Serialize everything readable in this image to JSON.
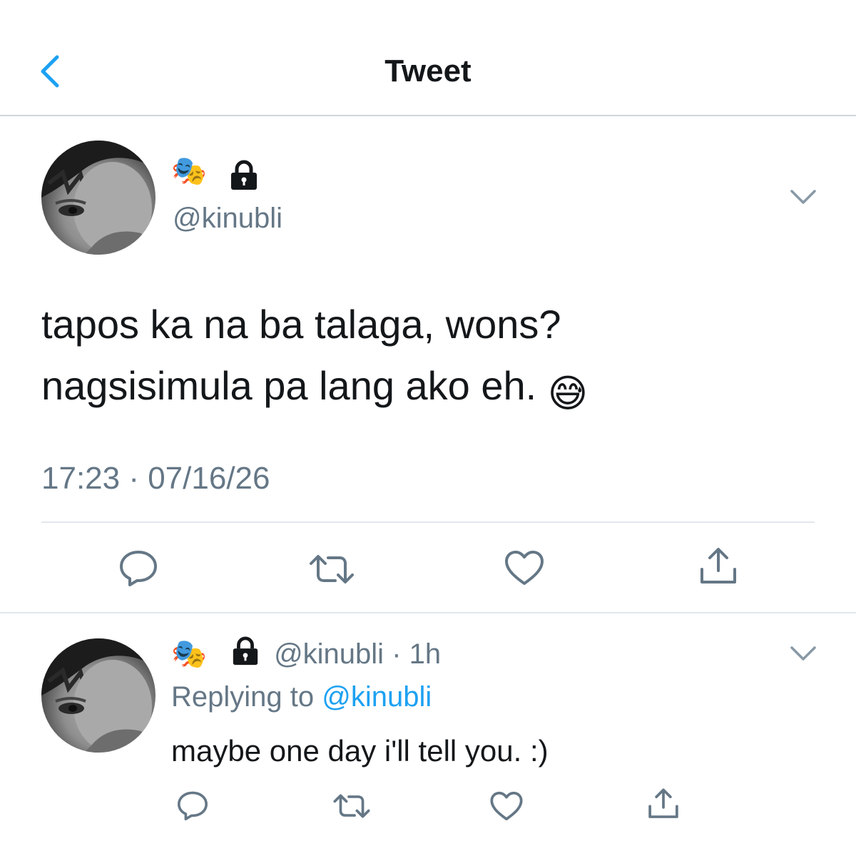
{
  "header": {
    "title": "Tweet",
    "back_icon": "chevron-left-icon"
  },
  "colors": {
    "accent": "#1da1f2",
    "secondary_text": "#657786",
    "divider": "#e1e8ed"
  },
  "main_tweet": {
    "display_name_emoji": "🎭",
    "locked": true,
    "handle": "@kinubli",
    "text_line1": "tapos ka na ba talaga, wons?",
    "text_line2": "nagsisimula pa lang ako eh.",
    "text_emoji": "😅",
    "timestamp": "17:23 · 07/16/26",
    "actions": [
      "reply-icon",
      "retweet-icon",
      "like-icon",
      "share-icon"
    ]
  },
  "reply_tweet": {
    "display_name_emoji": "🎭",
    "locked": true,
    "handle": "@kinubli",
    "time": "· 1h",
    "replying_prefix": "Replying to",
    "replying_to": "@kinubli",
    "text": "maybe one day i'll tell you. :)",
    "actions": [
      "reply-icon",
      "retweet-icon",
      "like-icon",
      "share-icon"
    ]
  }
}
